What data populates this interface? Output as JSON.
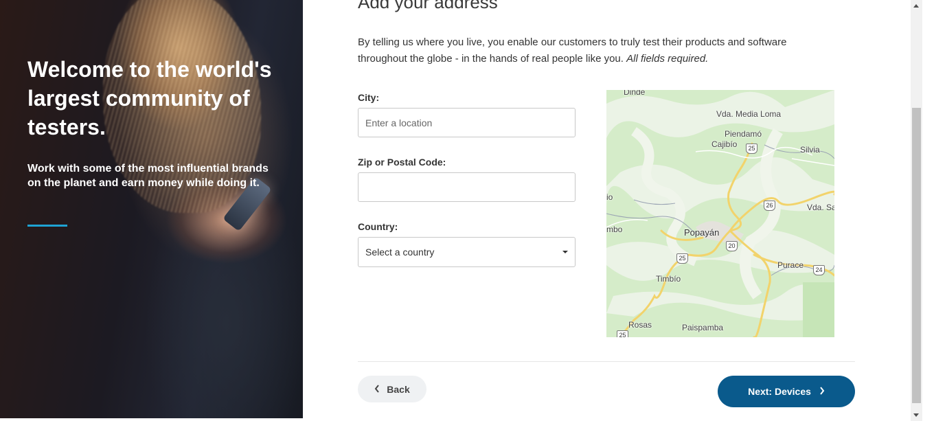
{
  "hero": {
    "title": "Welcome to the world's largest community of testers.",
    "subtitle": "Work with some of the most influential brands on the planet and earn money while doing it.",
    "accent_color": "#1ea3d4"
  },
  "form": {
    "title": "Add your address",
    "intro": "By telling us where you live, you enable our customers to truly test their products and software throughout the globe - in the hands of real people like you.",
    "intro_emphasis": "All fields required.",
    "city": {
      "label": "City:",
      "placeholder": "Enter a location",
      "value": ""
    },
    "zip": {
      "label": "Zip or Postal Code:",
      "placeholder": "",
      "value": ""
    },
    "country": {
      "label": "Country:",
      "selected": "Select a country",
      "icon": "caret-down-icon"
    }
  },
  "map": {
    "labels": [
      "Dinde",
      "Vda. Media Loma",
      "Piendamó",
      "Cajibío",
      "Silvia",
      "Vda. Sa",
      "io",
      "mbo",
      "Popayán",
      "Purace",
      "Timbío",
      "Rosas",
      "Paispamba"
    ],
    "route_shields": [
      "25",
      "26",
      "20",
      "25",
      "24",
      "25"
    ]
  },
  "nav": {
    "back_label": "Back",
    "back_icon": "chevron-left-icon",
    "next_label": "Next: Devices",
    "next_icon": "chevron-right-icon",
    "next_color": "#0a5a8c"
  }
}
